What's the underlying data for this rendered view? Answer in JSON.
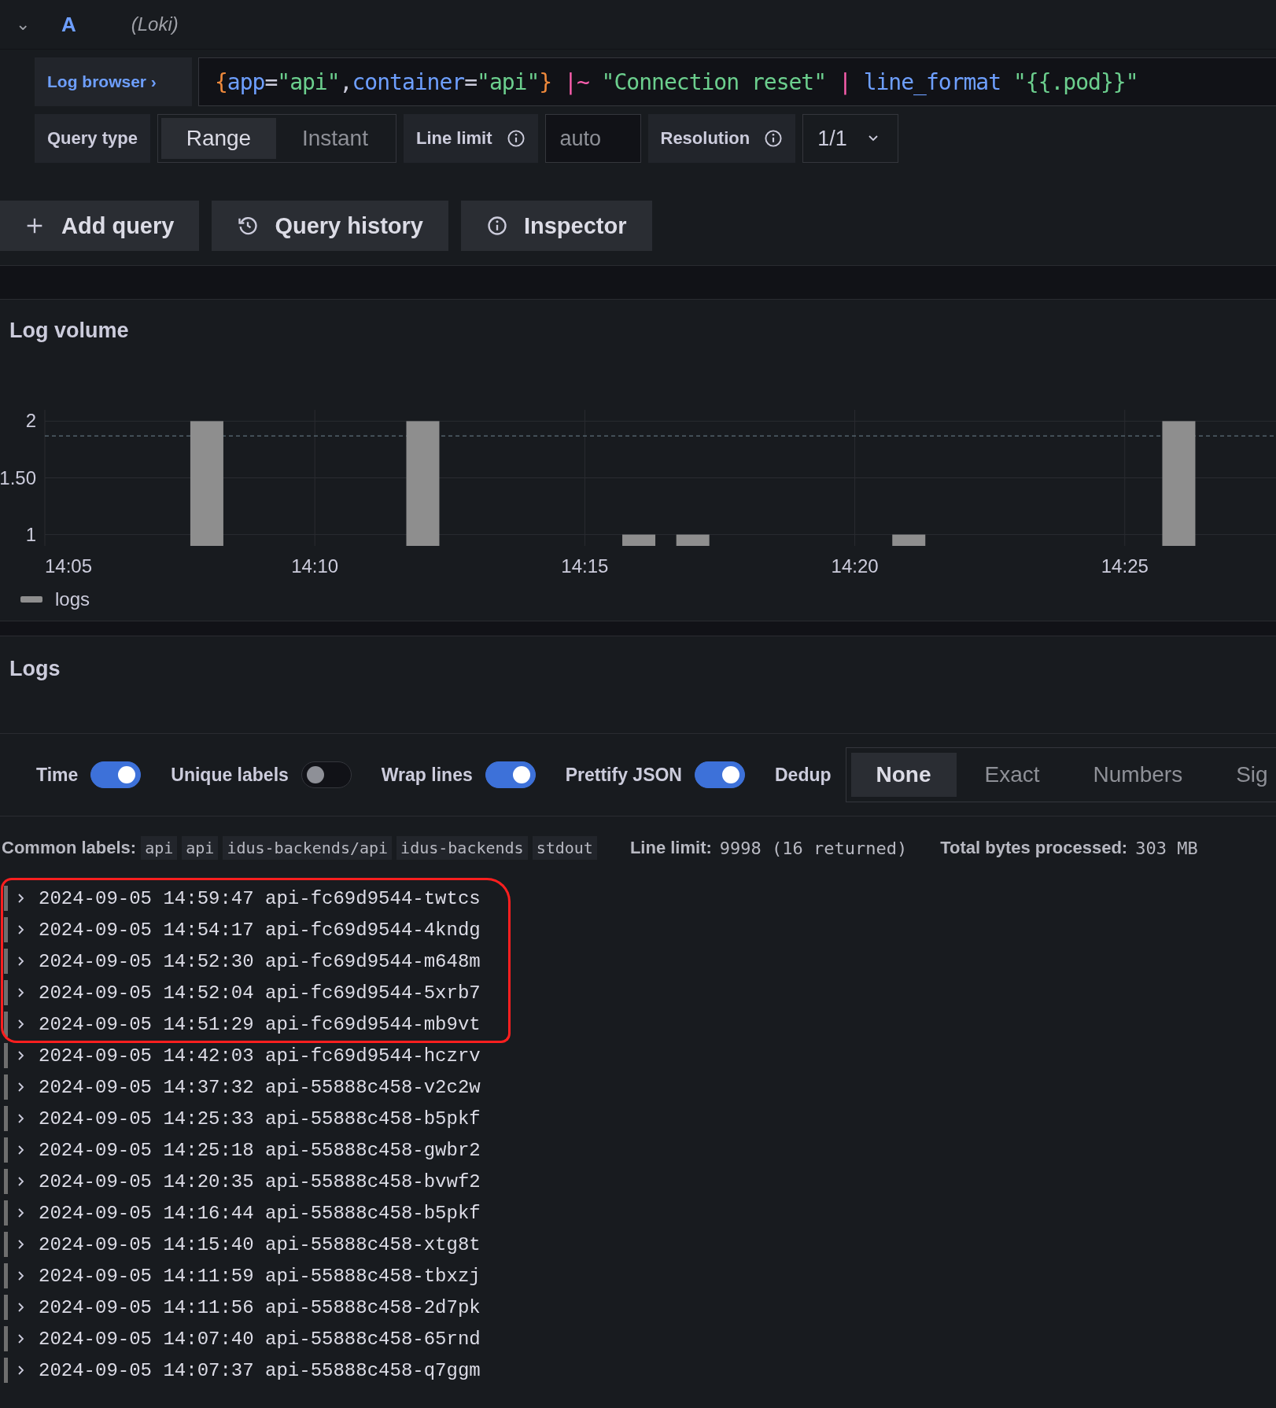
{
  "query_header": {
    "collapse": "⌄",
    "ref": "A",
    "datasource": "(Loki)"
  },
  "query": {
    "browser_button": "Log browser",
    "browser_caret": "›",
    "tokens": [
      {
        "text": "{",
        "kind": "brace"
      },
      {
        "text": "app",
        "kind": "label"
      },
      {
        "text": "=",
        "kind": "op"
      },
      {
        "text": "\"api\"",
        "kind": "string"
      },
      {
        "text": ",",
        "kind": "op"
      },
      {
        "text": "container",
        "kind": "label"
      },
      {
        "text": "=",
        "kind": "op"
      },
      {
        "text": "\"api\"",
        "kind": "string"
      },
      {
        "text": "}",
        "kind": "brace"
      },
      {
        "text": " |~",
        "kind": "pipe"
      },
      {
        "text": " \"Connection reset\"",
        "kind": "string"
      },
      {
        "text": " |",
        "kind": "pipe"
      },
      {
        "text": " line_format",
        "kind": "label"
      },
      {
        "text": " \"{{.pod}}\"",
        "kind": "string"
      }
    ]
  },
  "options": {
    "query_type_label": "Query type",
    "query_types": [
      {
        "label": "Range",
        "selected": true
      },
      {
        "label": "Instant",
        "selected": false
      }
    ],
    "line_limit_label": "Line limit",
    "line_limit_placeholder": "auto",
    "resolution_label": "Resolution",
    "resolution_value": "1/1"
  },
  "actions": [
    {
      "label": "Add query",
      "kind": "add"
    },
    {
      "label": "Query history",
      "kind": "history"
    },
    {
      "label": "Inspector",
      "kind": "inspector"
    }
  ],
  "log_volume": {
    "title": "Log volume",
    "chart_data": {
      "type": "bar",
      "categories": [
        "14:05",
        null,
        null,
        null,
        null,
        "14:10",
        null,
        null,
        null,
        null,
        "14:15",
        null,
        null,
        null,
        null,
        "14:20",
        null,
        null,
        null,
        null,
        "14:25",
        null,
        null
      ],
      "series": [
        {
          "name": "logs",
          "color": "#8e8e8e",
          "values": [
            null,
            null,
            null,
            2,
            null,
            null,
            null,
            2,
            null,
            null,
            null,
            1,
            1,
            null,
            null,
            null,
            1,
            null,
            null,
            null,
            null,
            2,
            null
          ]
        }
      ],
      "ylim": [
        0.9,
        2.1
      ],
      "yticks": [
        1,
        {
          "value": 1.5,
          "label": "1.50"
        },
        2
      ],
      "grid": true,
      "ref_lines": [
        {
          "axis": "y",
          "value": 1.87
        }
      ]
    }
  },
  "logs": {
    "title": "Logs",
    "toggles": [
      {
        "label": "Time",
        "on": true
      },
      {
        "label": "Unique labels",
        "on": false
      },
      {
        "label": "Wrap lines",
        "on": true
      },
      {
        "label": "Prettify JSON",
        "on": true
      }
    ],
    "dedup_label": "Dedup",
    "dedup_options": [
      {
        "label": "None",
        "selected": true
      },
      {
        "label": "Exact",
        "selected": false
      },
      {
        "label": "Numbers",
        "selected": false
      },
      {
        "label": "Sig",
        "selected": false
      }
    ],
    "common_labels_label": "Common labels:",
    "common_labels": [
      "api",
      "api",
      "idus-backends/api",
      "idus-backends",
      "stdout"
    ],
    "line_limit_label": "Line limit:",
    "line_limit_value": "9998 (16 returned)",
    "bytes_label": "Total bytes processed:",
    "bytes_value": "303 MB",
    "rows": [
      {
        "time": "2024-09-05 14:59:47",
        "pod": "api-fc69d9544-twtcs",
        "highlighted": true
      },
      {
        "time": "2024-09-05 14:54:17",
        "pod": "api-fc69d9544-4kndg",
        "highlighted": true
      },
      {
        "time": "2024-09-05 14:52:30",
        "pod": "api-fc69d9544-m648m",
        "highlighted": true
      },
      {
        "time": "2024-09-05 14:52:04",
        "pod": "api-fc69d9544-5xrb7",
        "highlighted": true
      },
      {
        "time": "2024-09-05 14:51:29",
        "pod": "api-fc69d9544-mb9vt",
        "highlighted": true
      },
      {
        "time": "2024-09-05 14:42:03",
        "pod": "api-fc69d9544-hczrv",
        "highlighted": false
      },
      {
        "time": "2024-09-05 14:37:32",
        "pod": "api-55888c458-v2c2w",
        "highlighted": false
      },
      {
        "time": "2024-09-05 14:25:33",
        "pod": "api-55888c458-b5pkf",
        "highlighted": false
      },
      {
        "time": "2024-09-05 14:25:18",
        "pod": "api-55888c458-gwbr2",
        "highlighted": false
      },
      {
        "time": "2024-09-05 14:20:35",
        "pod": "api-55888c458-bvwf2",
        "highlighted": false
      },
      {
        "time": "2024-09-05 14:16:44",
        "pod": "api-55888c458-b5pkf",
        "highlighted": false
      },
      {
        "time": "2024-09-05 14:15:40",
        "pod": "api-55888c458-xtg8t",
        "highlighted": false
      },
      {
        "time": "2024-09-05 14:11:59",
        "pod": "api-55888c458-tbxzj",
        "highlighted": false
      },
      {
        "time": "2024-09-05 14:11:56",
        "pod": "api-55888c458-2d7pk",
        "highlighted": false
      },
      {
        "time": "2024-09-05 14:07:40",
        "pod": "api-55888c458-65rnd",
        "highlighted": false
      },
      {
        "time": "2024-09-05 14:07:37",
        "pod": "api-55888c458-q7ggm",
        "highlighted": false
      }
    ]
  }
}
